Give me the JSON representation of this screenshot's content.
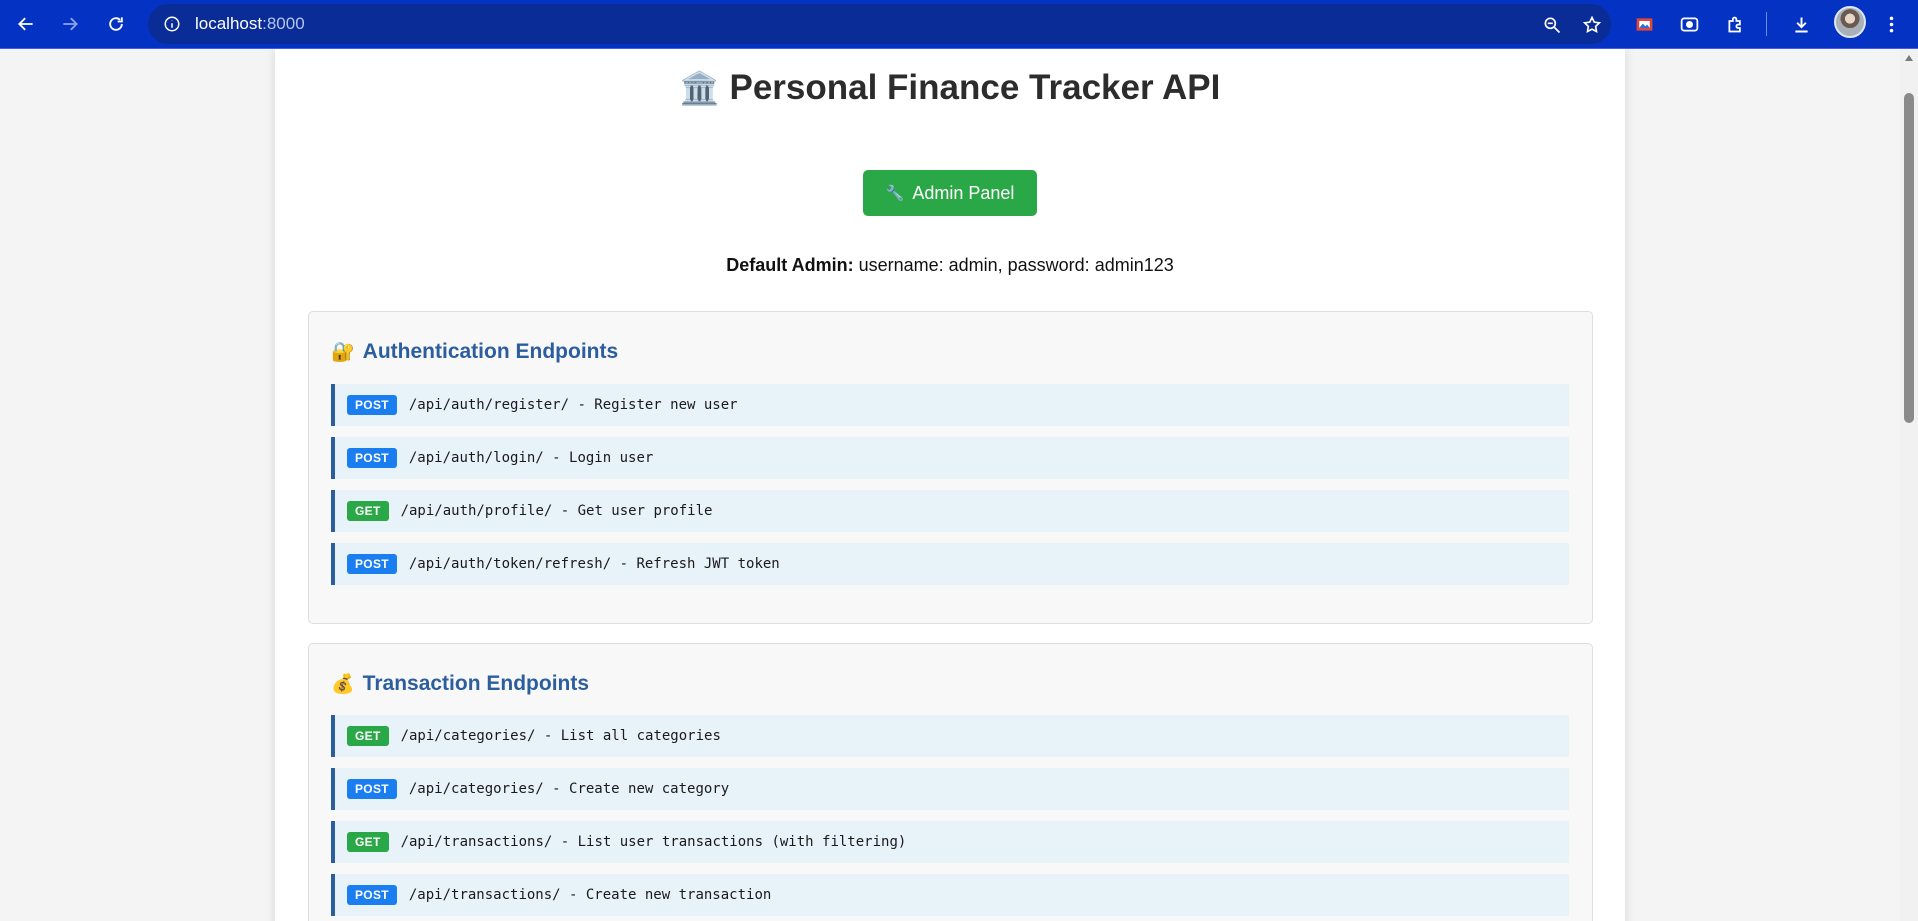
{
  "browser": {
    "url_host": "localhost",
    "url_port": ":8000",
    "icons": {
      "back": "back-arrow-icon",
      "forward": "forward-arrow-icon",
      "reload": "reload-icon",
      "site_info": "info-icon",
      "zoom": "zoom-icon",
      "bookmark": "star-icon",
      "extensions": "puzzle-icon",
      "download": "download-icon",
      "menu": "kebab-menu-icon"
    }
  },
  "page": {
    "title_emoji": "🏛️",
    "title": "Personal Finance Tracker API",
    "admin_button": {
      "emoji": "🔧",
      "label": "Admin Panel"
    },
    "default_admin": {
      "label": "Default Admin:",
      "value": "username: admin, password: admin123"
    }
  },
  "sections": [
    {
      "emoji": "🔐",
      "title": "Authentication Endpoints",
      "endpoints": [
        {
          "method": "POST",
          "text": "/api/auth/register/ - Register new user"
        },
        {
          "method": "POST",
          "text": "/api/auth/login/ - Login user"
        },
        {
          "method": "GET",
          "text": "/api/auth/profile/ - Get user profile"
        },
        {
          "method": "POST",
          "text": "/api/auth/token/refresh/ - Refresh JWT token"
        }
      ]
    },
    {
      "emoji": "💰",
      "title": "Transaction Endpoints",
      "endpoints": [
        {
          "method": "GET",
          "text": "/api/categories/ - List all categories"
        },
        {
          "method": "POST",
          "text": "/api/categories/ - Create new category"
        },
        {
          "method": "GET",
          "text": "/api/transactions/ - List user transactions (with filtering)"
        },
        {
          "method": "POST",
          "text": "/api/transactions/ - Create new transaction"
        }
      ]
    }
  ],
  "colors": {
    "chrome": "#0433c4",
    "post": "#1b7ef0",
    "get": "#2aa746",
    "section_title": "#2c5e9e",
    "endpoint_bg": "#e7f2f9"
  }
}
